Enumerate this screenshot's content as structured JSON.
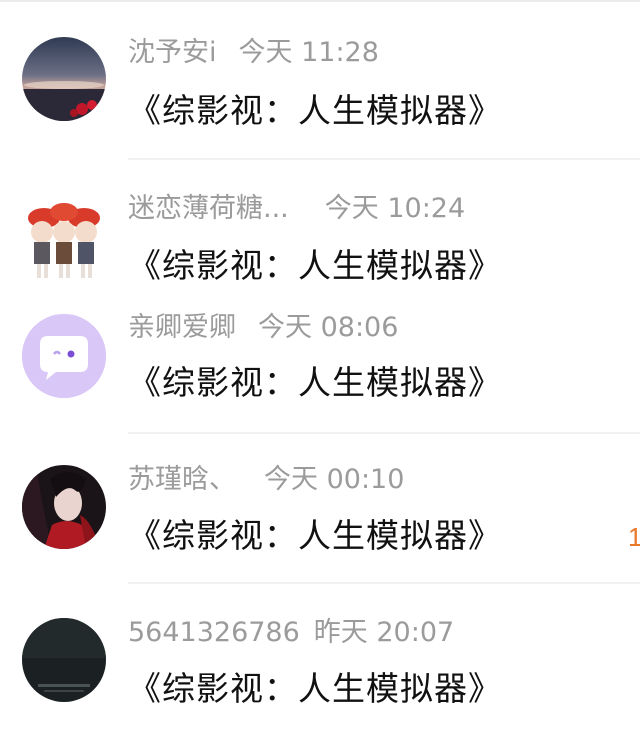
{
  "messages": [
    {
      "name": "沈予安i",
      "time": "今天 11:28",
      "title": "《综影视：人生模拟器》",
      "avatar": "sunset-landscape-avatar"
    },
    {
      "name": "迷恋薄荷糖...",
      "time": "今天 10:24",
      "title": "《综影视：人生模拟器》",
      "avatar": "anime-group-avatar"
    },
    {
      "name": "亲卿爱卿",
      "time": "今天 08:06",
      "title": "《综影视：人生模拟器》",
      "avatar": "chat-face-avatar"
    },
    {
      "name": "苏瑾晗、",
      "time": "今天 00:10",
      "title": "《综影视：人生模拟器》",
      "avatar": "anime-portrait-avatar"
    },
    {
      "name": "5641326786",
      "time": "昨天 20:07",
      "title": "《综影视：人生模拟器》",
      "avatar": "dark-photo-avatar"
    }
  ],
  "edge_mark": "1",
  "colors": {
    "meta_text": "#9b9b9b",
    "title_text": "#111111",
    "avatar_purple_bg": "#d9c8f7",
    "accent_orange": "#e87a2a"
  }
}
